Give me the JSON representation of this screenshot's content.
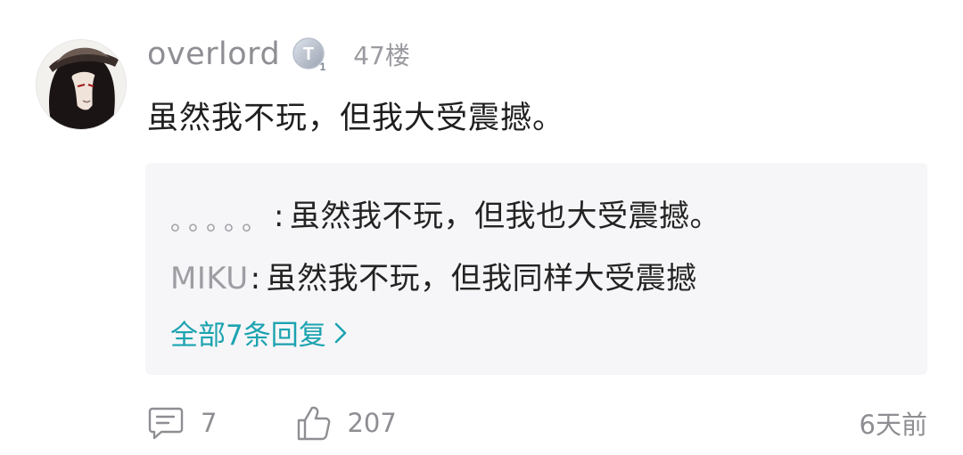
{
  "comment": {
    "avatar_icon": "anime-avatar-icon",
    "username": "overlord",
    "level_badge_icon": "level-badge-icon",
    "floor": "47楼",
    "text": "虽然我不玩，但我大受震撼。"
  },
  "replies": {
    "items": [
      {
        "author": "。。。。。",
        "separator": ":",
        "text": "虽然我不玩，但我也大受震撼。"
      },
      {
        "author": "MIKU",
        "separator": ":",
        "text": "虽然我不玩，但我同样大受震撼"
      }
    ],
    "view_all_label": "全部7条回复",
    "view_all_icon": "chevron-right-icon",
    "link_color": "#1ba3b0"
  },
  "footer": {
    "reply_icon": "comment-icon",
    "reply_count": "7",
    "like_icon": "thumbs-up-icon",
    "like_count": "207",
    "time": "6天前"
  }
}
